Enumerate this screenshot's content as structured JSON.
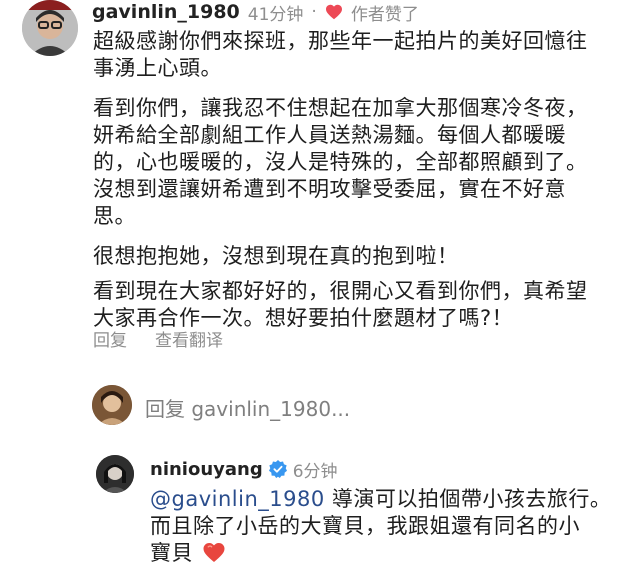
{
  "colors": {
    "accent": "#2a4d8c",
    "muted": "#8e8e8e",
    "heart": "#ed4956",
    "verified": "#3897f0"
  },
  "comment1": {
    "username": "gavinlin_1980",
    "time": "41分钟",
    "dot": "·",
    "liked_label": "作者赞了",
    "paragraphs": [
      [
        "超級感謝你們來探班，那些年一起拍片的美好回憶往",
        "事湧上心頭。"
      ],
      [
        "看到你們，讓我忍不住想起在加拿大那個寒冷冬夜，",
        "妍希給全部劇組工作人員送熱湯麵。每個人都暖暖",
        "的，心也暖暖的，沒人是特殊的，全部都照顧到了。",
        "沒想到還讓妍希遭到不明攻擊受委屈，實在不好意",
        "思。"
      ],
      [
        "很想抱抱她，沒想到現在真的抱到啦！"
      ],
      [
        "看到現在大家都好好的，很開心又看到你們，真希望",
        "大家再合作一次。想好要拍什麼題材了嗎?！"
      ]
    ],
    "reply_label": "回复",
    "translate_label": "查看翻译"
  },
  "reply_box": {
    "placeholder": "回复 gavinlin_1980..."
  },
  "comment2": {
    "username": "niniouyang",
    "time": "6分钟",
    "mention": "@gavinlin_1980",
    "line1_rest": " 導演可以拍個帶小孩去旅行。",
    "line2": "而且除了小岳的大寶貝，我跟姐還有同名的小",
    "line3": "寶貝"
  }
}
